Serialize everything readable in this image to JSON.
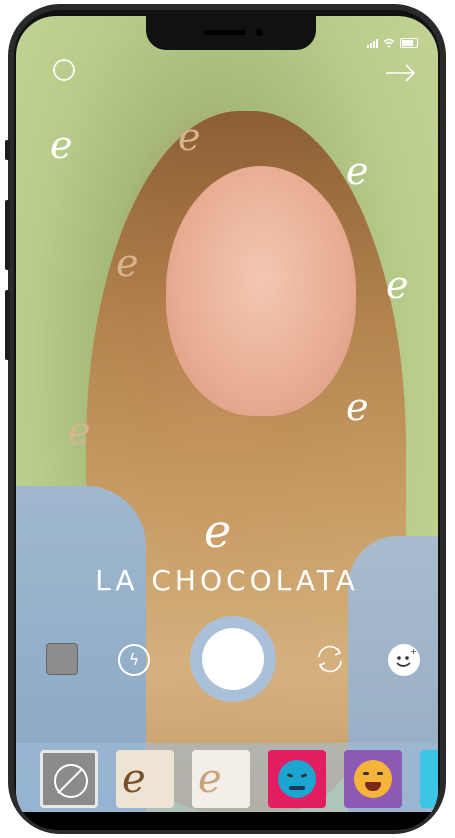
{
  "app": {
    "brand_mark": "e",
    "brand_name": "LA CHOCOLATA"
  },
  "status_bar": {
    "icons": [
      "signal-bars-icon",
      "wifi-icon",
      "battery-icon"
    ]
  },
  "top_bar": {
    "left_icon": "settings-ring-icon",
    "right_icon": "arrow-right-icon"
  },
  "overlay": {
    "doodle_glyph": "e",
    "colors": {
      "white": "#ffffff",
      "beige": "#d7b490"
    }
  },
  "camera_controls": {
    "icons": [
      "gallery-square-icon",
      "flash-icon",
      "shutter-button",
      "flip-camera-icon",
      "face-effects-icon"
    ],
    "flash_glyph": "ϟ"
  },
  "filters": [
    {
      "name": "none",
      "icon": "no-filter-icon"
    },
    {
      "name": "chocolata-dark",
      "glyph": "e"
    },
    {
      "name": "chocolata-light",
      "glyph": "e"
    },
    {
      "name": "angry",
      "icon": "angry-face-icon"
    },
    {
      "name": "laughing",
      "icon": "laughing-face-icon"
    },
    {
      "name": "more",
      "icon": "partial-filter"
    }
  ],
  "colors": {
    "shutter_ring": "#a9c0d8",
    "tray_bg": "#a0bedc",
    "filter_angry_bg": "#e21d62",
    "filter_laugh_bg": "#8a5ab4",
    "filter_cyan_bg": "#3cc6e6"
  }
}
